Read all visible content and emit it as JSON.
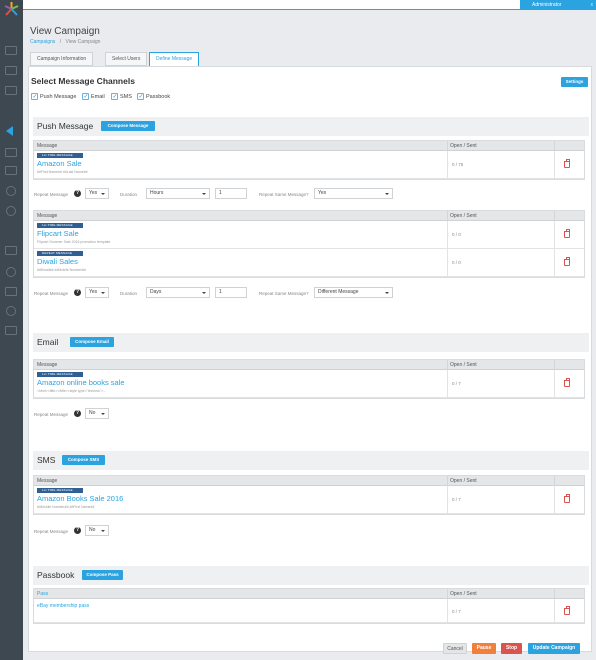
{
  "topbar": {
    "user": "Administrator",
    "close": "x"
  },
  "page": {
    "title": "View Campaign"
  },
  "breadcrumb": {
    "root": "Campaigns",
    "sep": "/",
    "current": "View Campaign"
  },
  "tabs": [
    {
      "label": "Campaign Information"
    },
    {
      "label": "Select Users"
    },
    {
      "label": "Define Message"
    }
  ],
  "channels": {
    "title": "Select Message Channels",
    "settings_label": "Settings",
    "options": [
      {
        "label": "Push Message",
        "checked": true
      },
      {
        "label": "Email",
        "checked": true
      },
      {
        "label": "SMS",
        "checked": true
      },
      {
        "label": "Passbook",
        "checked": true
      }
    ]
  },
  "columns": {
    "message": "Message",
    "open_sent": "Open / Sent",
    "pass": "Pass"
  },
  "push": {
    "title": "Push Message",
    "compose": "Compose Message",
    "group1": {
      "rows": [
        {
          "badge": "1st TIME MESSAGE",
          "name": "Amazon Sale",
          "sub": "##First Name## ##Last Name##",
          "stat": "0 / 75"
        }
      ],
      "repeat_label": "Repeat Message",
      "repeat_value": "Yes",
      "duration_label": "Duration",
      "duration_value": "Hours",
      "count_value": "1",
      "same_label": "Repeat Same Message?",
      "same_value": "Yes"
    },
    "group2": {
      "rows": [
        {
          "badge": "1st TIME MESSAGE",
          "name": "Flipcart Sale",
          "sub": "Flipcart Summer Sale 2016 promotion template",
          "stat": "0 / 0"
        },
        {
          "badge": "REPEAT MESSAGE",
          "name": "Diwali Sales",
          "sub": "##Email## ##Mobile Number##",
          "stat": "0 / 0"
        }
      ],
      "repeat_label": "Repeat Message",
      "repeat_value": "Yes",
      "duration_label": "Duration",
      "duration_value": "Days",
      "count_value": "1",
      "same_label": "Repeat Same Message?",
      "same_value": "Different Message"
    }
  },
  "email": {
    "title": "Email",
    "compose": "Compose Email",
    "rows": [
      {
        "badge": "1st TIME MESSAGE",
        "name": "Amazon online books sale",
        "sub": "<html><title></title><style type=\"text/css\">...",
        "stat": "0 / 7"
      }
    ],
    "repeat_label": "Repeat Message",
    "repeat_value": "No"
  },
  "sms": {
    "title": "SMS",
    "compose": "Compose SMS",
    "rows": [
      {
        "badge": "1st TIME MESSAGE",
        "name": "Amazon Books Sale 2016",
        "sub": "##Mobile Number## ##First Name##",
        "stat": "0 / 7"
      }
    ],
    "repeat_label": "Repeat Message",
    "repeat_value": "No"
  },
  "passbook": {
    "title": "Passbook",
    "compose": "Compose Pass",
    "rows": [
      {
        "name": "eBay membership pass",
        "stat": "0 / 7"
      }
    ]
  },
  "footer": {
    "cancel": "Cancel",
    "pause": "Pause",
    "stop": "Stop",
    "update": "Update Campaign"
  },
  "colors": {
    "accent": "#2aa3e0",
    "sidebar": "#3d4851",
    "pause": "#f0803c",
    "stop": "#d9534f",
    "badge": "#2f5f93"
  }
}
